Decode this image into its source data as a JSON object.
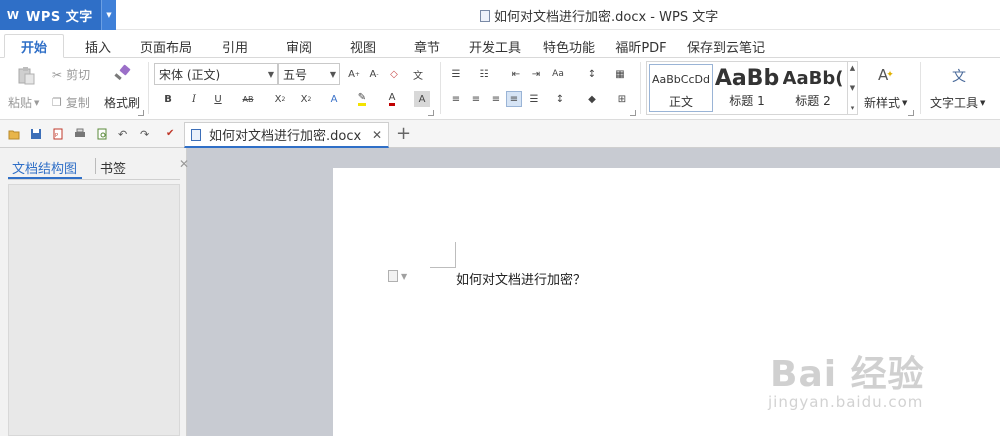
{
  "app": {
    "name": "WPS 文字",
    "window_title": "如何对文档进行加密.docx - WPS 文字"
  },
  "menu": {
    "tabs": [
      "开始",
      "插入",
      "页面布局",
      "引用",
      "审阅",
      "视图",
      "章节",
      "开发工具",
      "特色功能",
      "福昕PDF",
      "保存到云笔记"
    ],
    "active": "开始"
  },
  "ribbon": {
    "clipboard": {
      "paste": "粘贴",
      "cut": "剪切",
      "copy": "复制",
      "format_painter": "格式刷"
    },
    "font": {
      "family": "宋体 (正文)",
      "size": "五号"
    },
    "styles": [
      {
        "preview": "AaBbCcDd",
        "name": "正文"
      },
      {
        "preview": "AaBb",
        "name": "标题 1"
      },
      {
        "preview": "AaBb(",
        "name": "标题 2"
      }
    ],
    "new_style": "新样式",
    "text_tools": "文字工具"
  },
  "doc_tab": {
    "title": "如何对文档进行加密.docx"
  },
  "nav_pane": {
    "tabs": [
      "文档结构图",
      "书签"
    ]
  },
  "document": {
    "text": "如何对文档进行加密？"
  },
  "watermark": {
    "brand": "Bai 经验",
    "url": "jingyan.baidu.com"
  },
  "colors": {
    "accent": "#2f6fc7",
    "workspace": "#c8cbd2"
  }
}
